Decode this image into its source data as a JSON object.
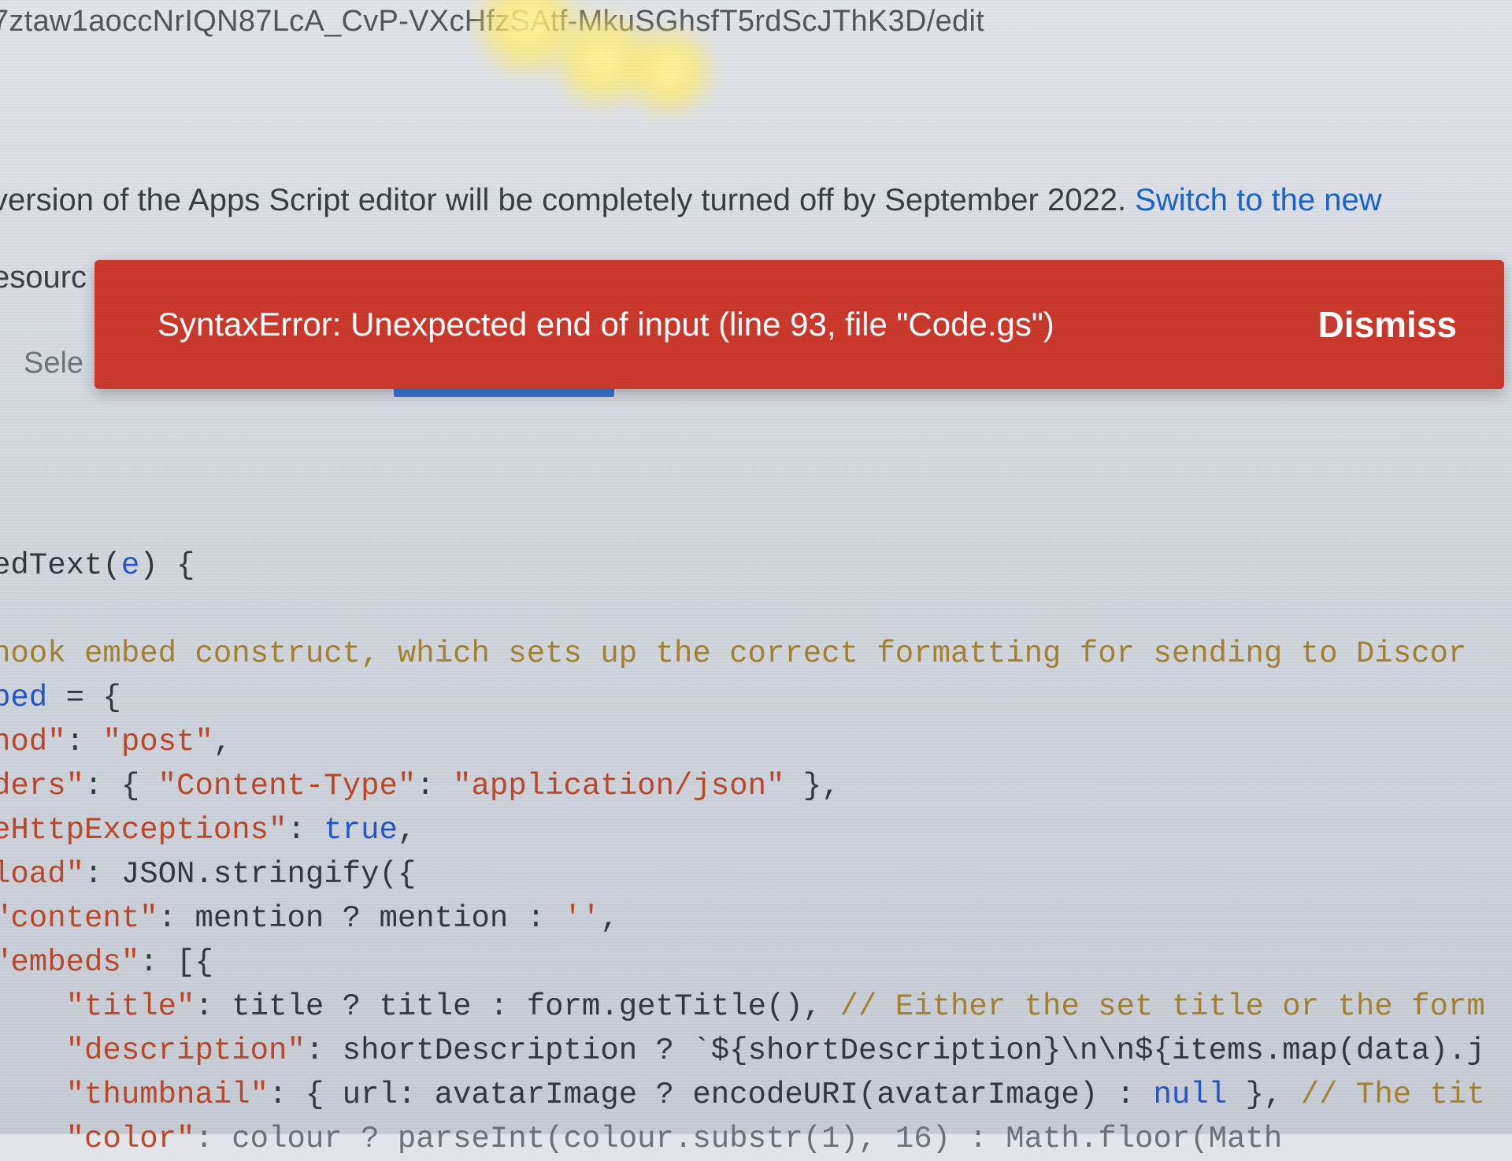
{
  "url_fragment": "7ztaw1aoccNrIQN87LcA_CvP-VXcHfzSAtf-MkuSGhsfT5rdScJThK3D/edit",
  "notice": {
    "text_before_link": "version of the Apps Script editor will be completely turned off by September 2022.  ",
    "link_text": "Switch to the new"
  },
  "menu_fragment": "esourc",
  "sele_fragment": "Sele",
  "toast": {
    "message": "SyntaxError: Unexpected end of input (line 93, file \"Code.gs\")",
    "dismiss_label": "Dismiss"
  },
  "code": {
    "l1_a": "edText(",
    "l1_b": "e",
    "l1_c": ") {",
    "l2_cmnt": "hook embed construct, which sets up the correct formatting for sending to Discor",
    "l3_a": "bed",
    "l3_b": " = {",
    "l4_a": "hod\"",
    "l4_b": ": ",
    "l4_c": "\"post\"",
    "l4_d": ",",
    "l5_a": "ders\"",
    "l5_b": ": { ",
    "l5_c": "\"Content-Type\"",
    "l5_d": ": ",
    "l5_e": "\"application/json\"",
    "l5_f": " },",
    "l6_a": "eHttpExceptions\"",
    "l6_b": ": ",
    "l6_c": "true",
    "l6_d": ",",
    "l7_a": "load\"",
    "l7_b": ": JSON.stringify({",
    "l8_a": "\"content\"",
    "l8_b": ": mention ? mention : ",
    "l8_c": "''",
    "l8_d": ",",
    "l9_a": "\"embeds\"",
    "l9_b": ": [{",
    "l10_a": "    \"title\"",
    "l10_b": ": title ? title : form.getTitle(), ",
    "l10_c": "// Either the set title or the form",
    "l11_a": "    \"description\"",
    "l11_b": ": shortDescription ? `${shortDescription}\\n\\n${items.map(data).j",
    "l12_a": "    \"thumbnail\"",
    "l12_b": ": { url: avatarImage ? encodeURI(avatarImage) : ",
    "l12_c": "null",
    "l12_d": " }, ",
    "l12_e": "// The tit",
    "l13_a": "    \"color\"",
    "l13_b": ": colour ? parseInt(colour.substr(1), 16) : Math.floor(Math"
  }
}
